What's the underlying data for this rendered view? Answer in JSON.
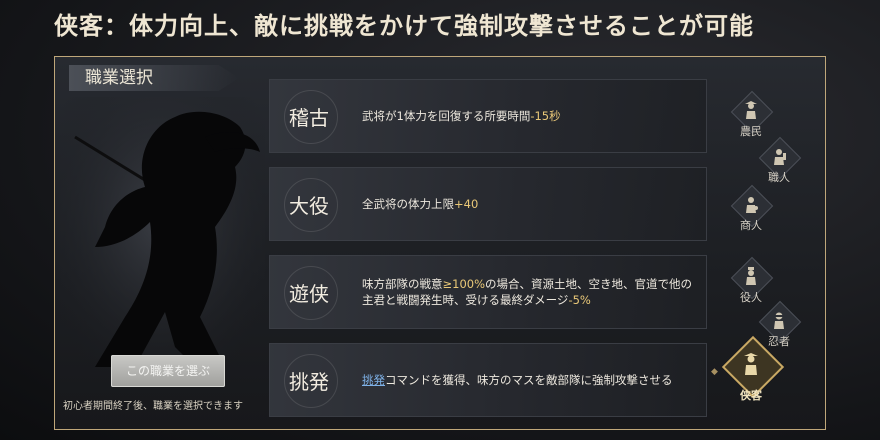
{
  "headline": "侠客：体力向上、敵に挑戦をかけて強制攻撃させることが可能",
  "panel": {
    "title": "職業選択",
    "select_button": "この職業を選ぶ",
    "unlock_note": "初心者期間終了後、職業を選択できます"
  },
  "skills": [
    {
      "name": "稽古",
      "desc_pre": "武将が1体力を回復する所要時間",
      "highlight": "-15秒",
      "desc_post": ""
    },
    {
      "name": "大役",
      "desc_pre": "全武将の体力上限",
      "highlight": "+40",
      "desc_post": ""
    },
    {
      "name": "遊侠",
      "desc_pre": "味方部隊の戦意",
      "highlight": "≥100%",
      "desc_mid": "の場合、資源土地、空き地、官道で他の主君と戦闘発生時、受ける最終ダメージ",
      "highlight2": "-5%"
    },
    {
      "name": "挑発",
      "link": "挑発",
      "desc_post": "コマンドを獲得、味方のマスを敵部隊に強制攻撃させる"
    }
  ],
  "classes": [
    {
      "label": "農民",
      "icon": "farmer-icon"
    },
    {
      "label": "職人",
      "icon": "craftsman-icon"
    },
    {
      "label": "商人",
      "icon": "merchant-icon"
    },
    {
      "label": "役人",
      "icon": "official-icon"
    },
    {
      "label": "忍者",
      "icon": "ninja-icon"
    },
    {
      "label": "侠客",
      "icon": "kyokaku-icon",
      "selected": true
    }
  ],
  "colors": {
    "accent_gold": "#c9a964",
    "highlight": "#e9c878",
    "link": "#7fb2e8"
  }
}
